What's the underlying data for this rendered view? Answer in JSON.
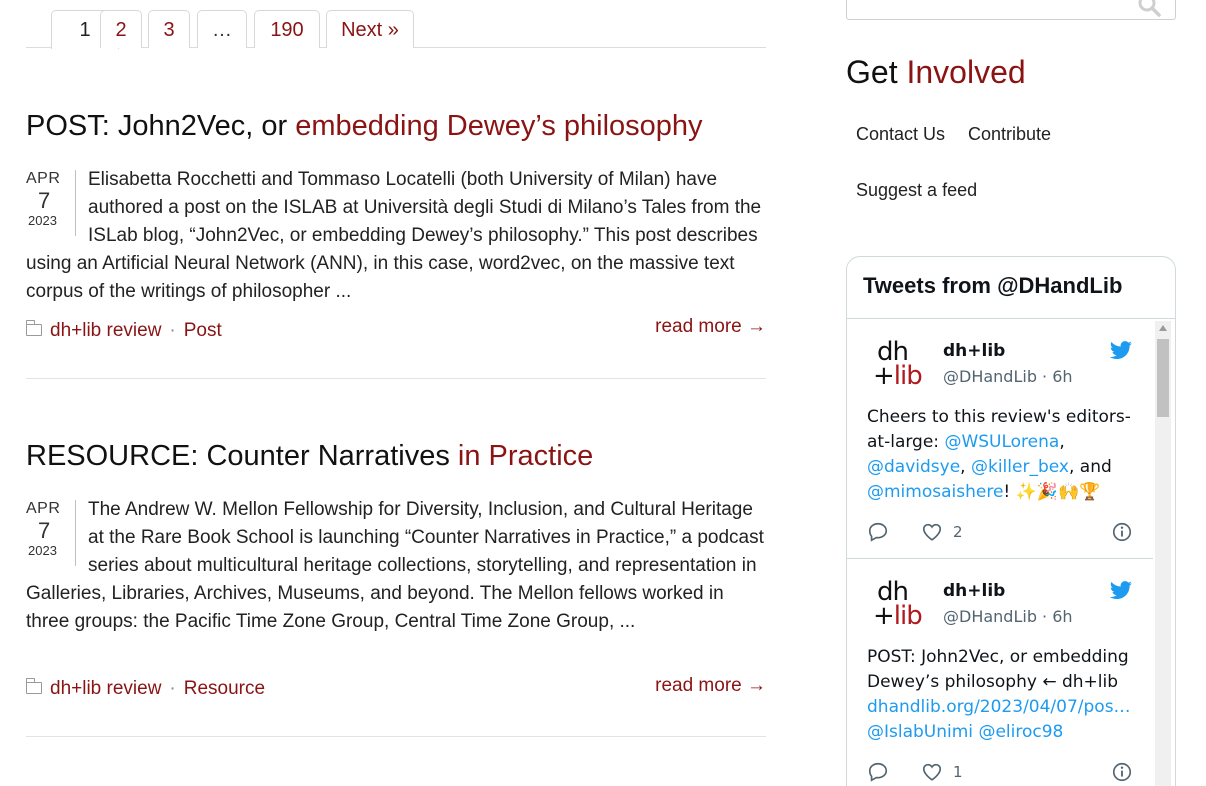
{
  "pagination": {
    "pages": [
      "1",
      "2",
      "3",
      "…",
      "190"
    ],
    "next": "Next »"
  },
  "posts": [
    {
      "title_prefix": "POST: John2Vec, or ",
      "title_link": "embedding Dewey’s philosophy",
      "date": {
        "month": "APR",
        "day": "7",
        "year": "2023"
      },
      "excerpt": "Elisabetta Rocchetti and Tommaso Locatelli (both University of Milan) have authored a post on the ISLAB at Università degli Studi di Milano’s Tales from the ISLab blog, “John2Vec, or embedding Dewey’s philosophy.” This post describes using an Artificial Neural Network (ANN), in this case, word2vec, on the massive text corpus of the writings of philosopher ...",
      "categories": [
        "dh+lib review",
        "Post"
      ],
      "read_more": "read more →"
    },
    {
      "title_prefix": "RESOURCE: Counter Narratives ",
      "title_link": "in Practice",
      "date": {
        "month": "APR",
        "day": "7",
        "year": "2023"
      },
      "excerpt": "The Andrew W. Mellon Fellowship for Diversity, Inclusion, and Cultural Heritage at the Rare Book School is launching “Counter Narratives in Practice,” a podcast series about multicultural heritage collections, storytelling, and representation in Galleries, Libraries, Archives, Museums, and beyond. The Mellon fellows worked in three groups: the Pacific Time Zone Group, Central Time Zone Group, ...",
      "categories": [
        "dh+lib review",
        "Resource"
      ],
      "read_more": "read more →"
    }
  ],
  "sidebar": {
    "heading_prefix": "Get ",
    "heading_accent": "Involved",
    "links": [
      "Contact Us",
      "Contribute",
      "Suggest a feed"
    ]
  },
  "twitter": {
    "header": "Tweets from @DHandLib",
    "logo_top": "dh",
    "logo_bottom_plus": "+",
    "logo_bottom_lib": "lib",
    "tweets": [
      {
        "name": "dh+lib",
        "handle": "@DHandLib · 6h",
        "text_plain_1": "Cheers to this review's editors-at-large: ",
        "mention_1": "@WSULorena",
        "comma_1": ",",
        "mention_2": "@davidsye",
        "comma_2": ", ",
        "mention_3": "@killer_bex",
        "and": ", and",
        "mention_4": "@mimosaishere",
        "emoji_tail": "! ✨🎉🙌🏆",
        "likes": "2"
      },
      {
        "name": "dh+lib",
        "handle": "@DHandLib · 6h",
        "text_plain_1": "POST: John2Vec, or embedding Dewey’s philosophy ← dh+lib",
        "link": "dhandlib.org/2023/04/07/pos…",
        "mention_1": "@IslabUnimi",
        "mention_2": "@eliroc98",
        "likes": "1"
      }
    ]
  },
  "colors": {
    "accent": "#8a1414",
    "twitter_blue": "#1d9bf0",
    "logo_red": "#b0191e"
  },
  "icons": [
    "search-icon",
    "folder-icon",
    "twitter-bird-icon",
    "reply-icon",
    "heart-icon",
    "info-icon"
  ]
}
